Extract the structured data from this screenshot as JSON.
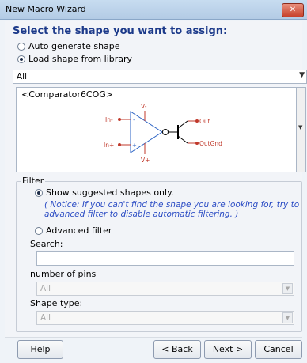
{
  "window": {
    "title": "New Macro Wizard",
    "close_glyph": "✕"
  },
  "heading": "Select the shape you want to assign:",
  "shape_source": {
    "options": [
      {
        "label": "Auto generate shape",
        "selected": false
      },
      {
        "label": "Load shape from library",
        "selected": true
      }
    ]
  },
  "library": {
    "value": "All",
    "arrow": "▼"
  },
  "shape_preview": {
    "name": "<Comparator6COG>",
    "pins": {
      "vminus": "V-",
      "vplus": "V+",
      "inminus": "In-",
      "inplus": "In+",
      "out": "Out",
      "outgnd": "OutGnd"
    },
    "minus_sign": "-",
    "plus_sign": "+"
  },
  "scroll_arrow": "▼",
  "filter": {
    "legend": "Filter",
    "show_suggested": {
      "label": "Show suggested shapes only.",
      "selected": true
    },
    "notice_line1": "( Notice: If you can't find the shape you are looking for, try to",
    "notice_line2": "advanced filter to disable automatic filtering. )",
    "advanced": {
      "label": "Advanced filter",
      "selected": false
    },
    "search_label": "Search:",
    "search_value": "",
    "pins_label": "number of pins",
    "pins_value": "All",
    "type_label": "Shape type:",
    "type_value": "All",
    "combo_arrow": "▼"
  },
  "buttons": {
    "help": "Help",
    "back": "< Back",
    "next": "Next >",
    "cancel": "Cancel"
  }
}
